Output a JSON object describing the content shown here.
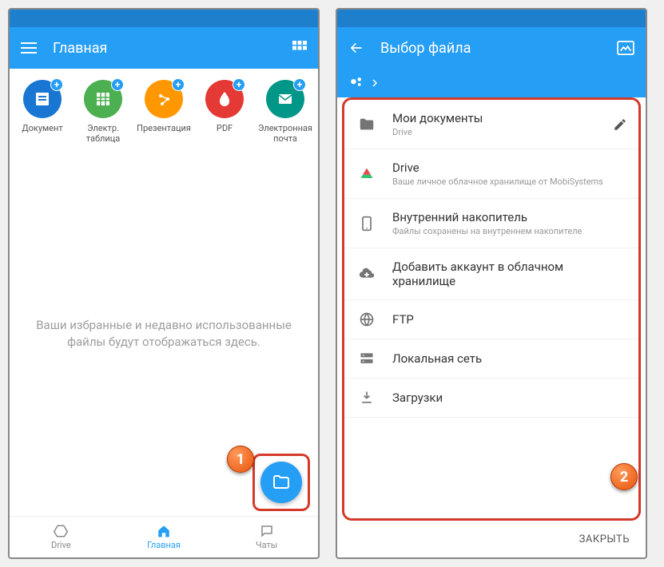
{
  "left": {
    "title": "Главная",
    "create_items": [
      {
        "label": "Документ",
        "bg": "bg-blue"
      },
      {
        "label": "Электр. таблица",
        "bg": "bg-green"
      },
      {
        "label": "Презентация",
        "bg": "bg-orange"
      },
      {
        "label": "PDF",
        "bg": "bg-red"
      },
      {
        "label": "Электронная почта",
        "bg": "bg-teal"
      }
    ],
    "placeholder": "Ваши избранные и недавно использованные файлы будут отображаться здесь.",
    "nav": {
      "drive": "Drive",
      "home": "Главная",
      "chats": "Чаты"
    },
    "callout": "1"
  },
  "right": {
    "title": "Выбор файла",
    "locations": [
      {
        "title": "Мои документы",
        "sub": "Drive",
        "editable": true
      },
      {
        "title": "Drive",
        "sub": "Ваше личное облачное хранилище от MobiSystems"
      },
      {
        "title": "Внутренний накопитель",
        "sub": "Файлы сохранены на внутреннем накопителе"
      },
      {
        "title": "Добавить аккаунт в облачном хранилище"
      },
      {
        "title": "FTP"
      },
      {
        "title": "Локальная сеть"
      },
      {
        "title": "Загрузки"
      }
    ],
    "close": "ЗАКРЫТЬ",
    "callout": "2"
  }
}
